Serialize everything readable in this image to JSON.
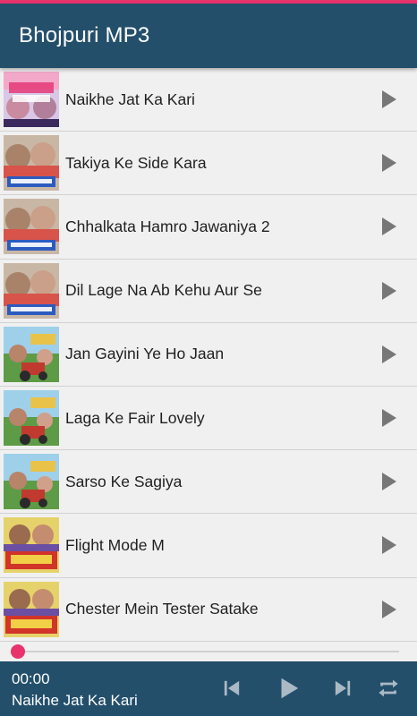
{
  "app": {
    "title": "Bhojpuri MP3",
    "colors": {
      "primary": "#234f6b",
      "accent": "#e8336d",
      "list_background": "#f0f0f0",
      "icon_gray": "#777777"
    }
  },
  "songs": [
    {
      "title": "Naikhe Jat Ka Kari",
      "thumbnail": "album-art-naikhe",
      "play_icon": "play-icon"
    },
    {
      "title": "Takiya Ke Side Kara",
      "thumbnail": "album-art-diwana",
      "play_icon": "play-icon"
    },
    {
      "title": "Chhalkata Hamro Jawaniya 2",
      "thumbnail": "album-art-diwana",
      "play_icon": "play-icon"
    },
    {
      "title": "Dil Lage Na Ab Kehu Aur Se",
      "thumbnail": "album-art-diwana",
      "play_icon": "play-icon"
    },
    {
      "title": "Jan Gayini Ye Ho Jaan",
      "thumbnail": "album-art-tractor",
      "play_icon": "play-icon"
    },
    {
      "title": " Laga Ke Fair Lovely",
      "thumbnail": "album-art-tractor",
      "play_icon": "play-icon"
    },
    {
      "title": "Sarso Ke Sagiya",
      "thumbnail": "album-art-tractor",
      "play_icon": "play-icon"
    },
    {
      "title": "Flight Mode M",
      "thumbnail": "album-art-champaran",
      "play_icon": "play-icon"
    },
    {
      "title": "Chester Mein Tester Satake",
      "thumbnail": "album-art-champaran",
      "play_icon": "play-icon"
    }
  ],
  "player": {
    "time": "00:00",
    "now_playing": "Naikhe Jat Ka Kari",
    "progress": 0,
    "controls": [
      "skip-previous-icon",
      "play-icon",
      "skip-next-icon",
      "repeat-icon"
    ]
  }
}
